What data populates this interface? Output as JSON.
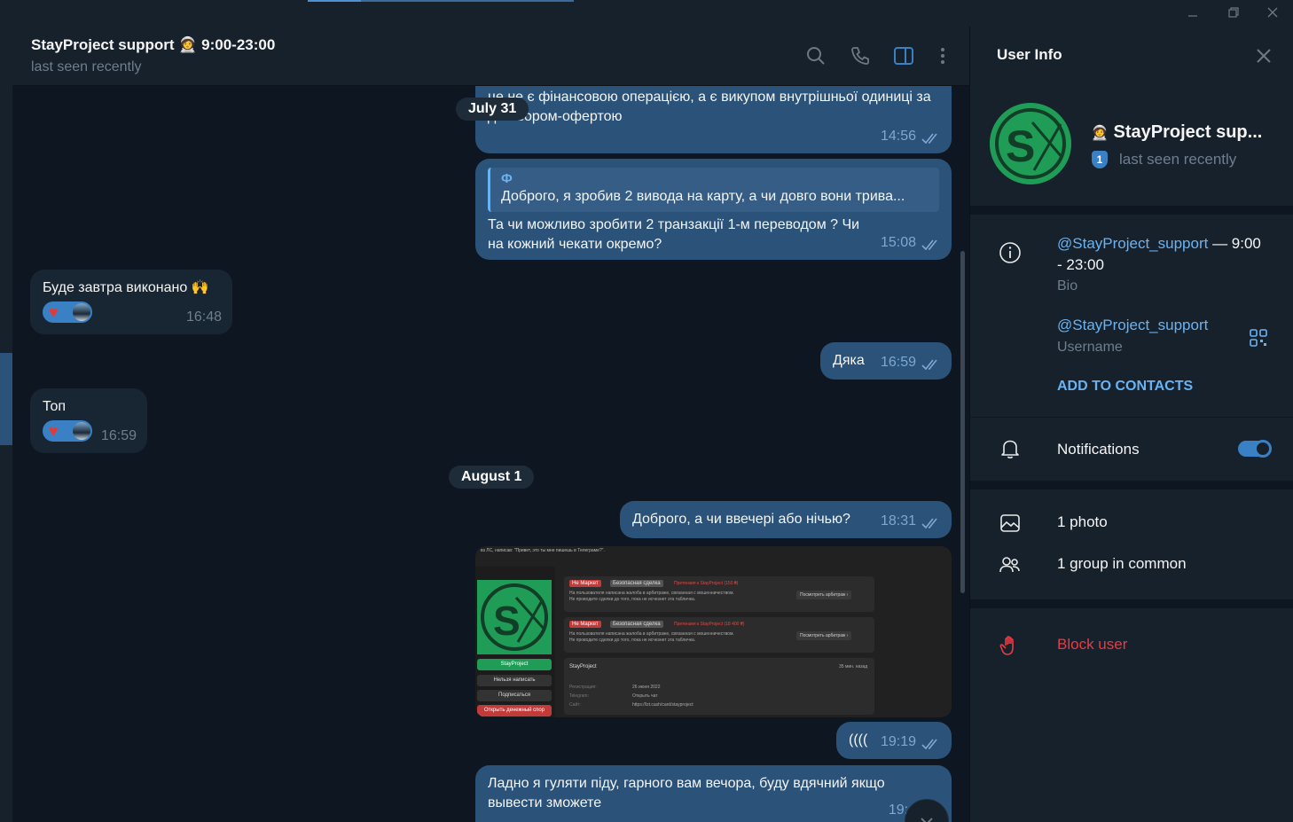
{
  "header": {
    "title": "StayProject support 🧑‍🚀 9:00-23:00",
    "title_emoji": "🧑‍🚀",
    "status": "last seen recently",
    "icons": [
      "search-icon",
      "phone-icon",
      "sidebar-toggle-icon",
      "more-vertical-icon"
    ]
  },
  "messages": {
    "m1_text": "це не є фінансовою операцією, а є викупом внутрішньої одиниці за договором-офертою",
    "m1_time": "14:56",
    "date1": "July 31",
    "m2_reply_name": "Ф",
    "m2_reply_text": "Доброго, я зробив 2 вивода на карту, а чи довго вони трива...",
    "m2_text": "Та чи можливо зробити 2 транзакції 1-м переводом ? Чи на кожний чекати окремо?",
    "m2_time": "15:08",
    "m3_text": "Буде завтра виконано 🙌",
    "m3_time": "16:48",
    "m4_text": "Дяка",
    "m4_time": "16:59",
    "m5_text": "Топ",
    "m5_time": "16:59",
    "date2": "August 1",
    "m6_text": "Доброго, а чи ввечері або нічью?",
    "m6_time": "18:31",
    "m7_text": "((((",
    "m7_time": "19:19",
    "m8_text": "Ладно я гуляти піду, гарного вам вечора, буду вдячний якщо вывести зможете",
    "m8_time": "19:4"
  },
  "screenshot_image": {
    "caption_line": "вз ЛС, написав: \"Привет, это ты мне пишешь в Телеграме?\".",
    "tag_market": "Не Маркет",
    "tag_safe": "Безопасная сделка",
    "claim1": "Претензия к StayProject (150 ₴)",
    "claim2": "Претензия к StayProject (18 400 ₴)",
    "desc_a": "На пользователя написана жалоба в арбитраже, связанная с мошенничеством.",
    "desc_b": "Не проводите сделки до того, пока не исчезнет эта табличка.",
    "view_btn": "Посмотреть арбитраж ›",
    "profile_name": "StayProject",
    "profile_ago": "35 мин. назад",
    "reg_label": "Регистрация:",
    "reg_value": "26 июня 2022",
    "tg_label": "Telegram:",
    "tg_value": "Открыть чат",
    "site_label": "Сайт:",
    "site_value": "https://lzt.cash/card/stayproject",
    "sidebar_name": "StayProject",
    "btn_write": "Нельзя написать",
    "btn_subscribe": "Подписаться",
    "btn_dispute": "Открыть денежный спор"
  },
  "panel": {
    "title": "User Info",
    "name": "StayProject sup...",
    "status": "last seen recently",
    "badge": "1",
    "bio_link": "@StayProject_support",
    "bio_rest": " — 9:00",
    "bio_line2": "- 23:00",
    "bio_label": "Bio",
    "username": "@StayProject_support",
    "username_label": "Username",
    "add_contacts": "ADD TO CONTACTS",
    "notifications": "Notifications",
    "notifications_on": true,
    "photos": "1 photo",
    "groups": "1 group in common",
    "block": "Block user"
  },
  "colors": {
    "bg": "#0e1621",
    "panel": "#17212b",
    "outgoing": "#2b5278",
    "incoming": "#182533",
    "accent": "#6ab3f3",
    "danger": "#ec3942",
    "logo_green": "#1f9d57"
  }
}
